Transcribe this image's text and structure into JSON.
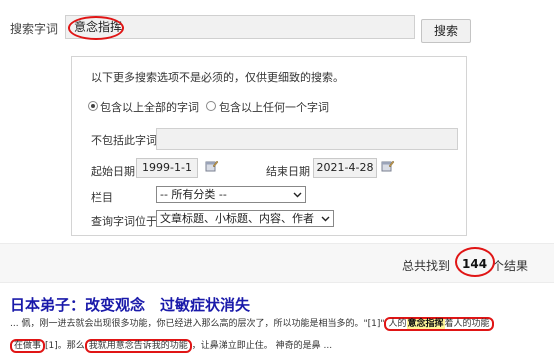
{
  "search": {
    "label": "搜索字词",
    "query": "意念指挥",
    "button_label": "搜索"
  },
  "advanced": {
    "note": "以下更多搜索选项不是必须的，仅供更细致的搜索。",
    "radio_all_label": "包含以上全部的字词",
    "radio_any_label": "包含以上任何一个字词",
    "exclude_label": "不包括此字词",
    "exclude_value": "",
    "start_label": "起始日期",
    "start_value": "1999-1-1",
    "end_label": "结束日期",
    "end_value": "2021-4-28",
    "column_label": "栏目",
    "column_value": "-- 所有分类 --",
    "position_label": "查询字词位于",
    "position_value": "文章标题、小标题、内容、作者"
  },
  "results_summary": {
    "prefix": "总共找到",
    "count": "144",
    "suffix": "个结果"
  },
  "result": {
    "title": "日本弟子：改变观念　过敏症状消失",
    "line1_a": "... 佩，刚一进去就会出现很多功能，你已经进入那么高的层次了，所以功能是相当多的。\"[1]\"",
    "line1_b": "人的",
    "line1_hl": "意念指挥",
    "line1_c": "着人的功能",
    "line2_a": "在做事",
    "line2_b": "[1]。那么",
    "line2_c": "我就用意念告诉我的功能",
    "line2_d": "，让鼻涕立即止住。 神奇的是鼻 ..."
  },
  "colors": {
    "highlight_ring": "#e01515",
    "keyword_highlight": "#fff59a",
    "result_link": "#1a1aaa"
  }
}
